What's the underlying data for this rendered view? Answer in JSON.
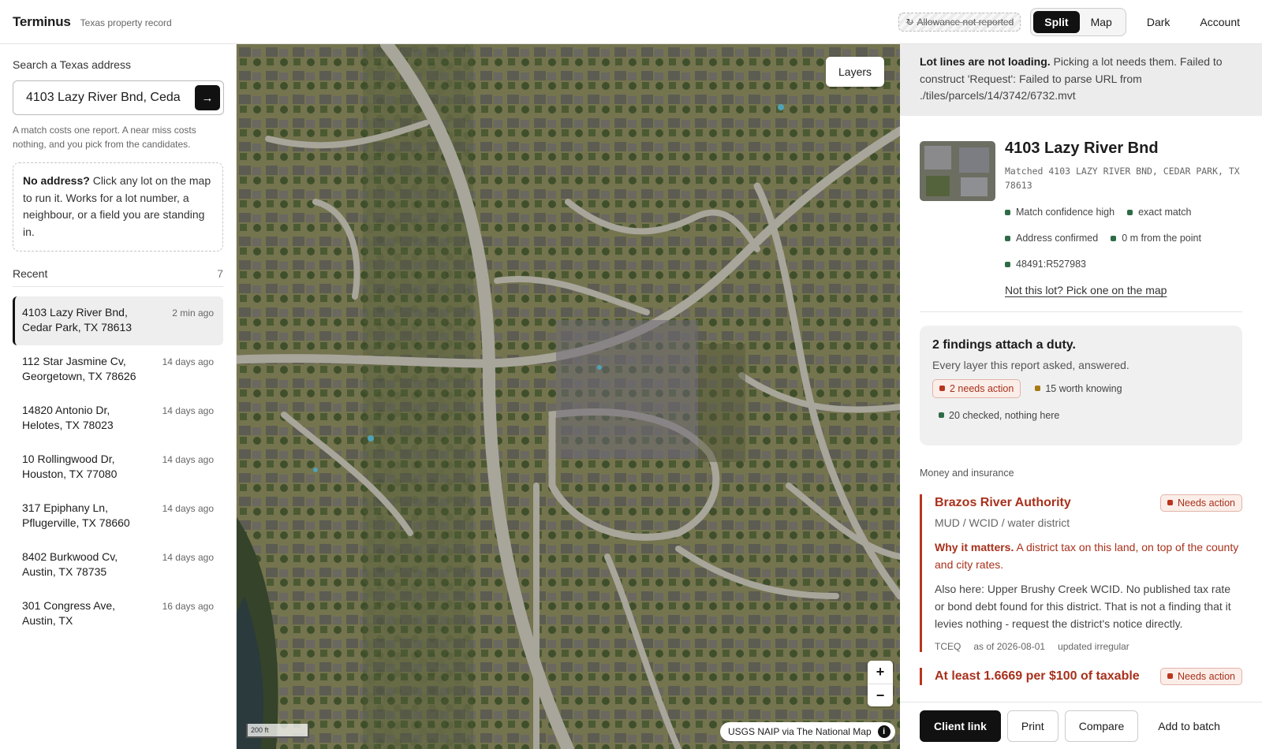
{
  "header": {
    "app_name": "Terminus",
    "subtitle": "Texas property record",
    "allowance": "Allowance not reported",
    "view_split": "Split",
    "view_map": "Map",
    "theme_label": "Dark",
    "account_label": "Account"
  },
  "sidebar": {
    "search_label": "Search a Texas address",
    "search_value": "4103 Lazy River Bnd, Ceda",
    "go_label": "→",
    "search_note": "A match costs one report. A near miss costs nothing, and you pick from the candidates.",
    "no_address_bold": "No address?",
    "no_address_text": "Click any lot on the map to run it. Works for a lot number, a neighbour, or a field you are standing in.",
    "recent_label": "Recent",
    "recent_count": "7",
    "recent": [
      {
        "address": "4103 Lazy River Bnd, Cedar Park, TX 78613",
        "time": "2 min ago"
      },
      {
        "address": "112 Star Jasmine Cv, Georgetown, TX 78626",
        "time": "14 days ago"
      },
      {
        "address": "14820 Antonio Dr, Helotes, TX 78023",
        "time": "14 days ago"
      },
      {
        "address": "10 Rollingwood Dr, Houston, TX 77080",
        "time": "14 days ago"
      },
      {
        "address": "317 Epiphany Ln, Pflugerville, TX 78660",
        "time": "14 days ago"
      },
      {
        "address": "8402 Burkwood Cv, Austin, TX 78735",
        "time": "14 days ago"
      },
      {
        "address": "301 Congress Ave, Austin, TX",
        "time": "16 days ago"
      }
    ]
  },
  "map": {
    "layers_label": "Layers",
    "zoom_in": "+",
    "zoom_out": "−",
    "scale": "200 ft",
    "attribution": "USGS NAIP via The National Map",
    "info_icon": "i"
  },
  "panel": {
    "alert_bold": "Lot lines are not loading.",
    "alert_text": "Picking a lot needs them. Failed to construct 'Request': Failed to parse URL from ./tiles/parcels/14/3742/6732.mvt",
    "property_title": "4103 Lazy River Bnd",
    "matched": "Matched 4103 LAZY RIVER BND, CEDAR PARK, TX 78613",
    "chips": [
      "Match confidence high",
      "exact match",
      "Address confirmed",
      "0 m from the point",
      "48491:R527983"
    ],
    "not_this_lot": "Not this lot? Pick one on the map",
    "findings_title": "2 findings attach a duty.",
    "findings_sub": "Every layer this report asked, answered.",
    "needs_action_count": "2 needs action",
    "worth_knowing": "15 worth knowing",
    "checked": "20 checked, nothing here",
    "section_label": "Money and insurance",
    "finding1": {
      "title": "Brazos River Authority",
      "badge": "Needs action",
      "kind": "MUD / WCID / water district",
      "why_bold": "Why it matters.",
      "why_text": "A district tax on this land, on top of the county and city rates.",
      "also": "Also here: Upper Brushy Creek WCID. No published tax rate or bond debt found for this district. That is not a finding that it levies nothing - request the district's notice directly.",
      "source": "TCEQ",
      "as_of": "as of 2026-08-01",
      "updated": "updated irregular"
    },
    "finding2": {
      "title": "At least 1.6669 per $100 of taxable",
      "badge": "Needs action"
    }
  },
  "actions": {
    "client_link": "Client link",
    "print": "Print",
    "compare": "Compare",
    "batch": "Add to batch"
  },
  "colors": {
    "accent": "#111111",
    "danger": "#b8361d",
    "ok": "#2f6b46",
    "warn": "#a87a12"
  }
}
